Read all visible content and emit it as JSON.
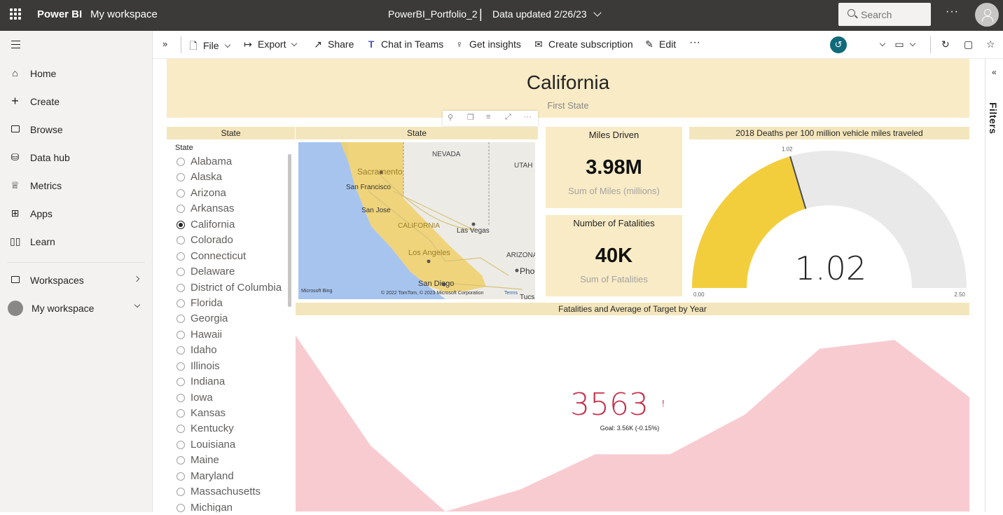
{
  "topbar": {
    "brand": "Power BI",
    "workspace_link": "My workspace",
    "report_name": "PowerBI_Portfolio_2",
    "separator": "|",
    "data_updated": "Data updated 2/26/23",
    "search_placeholder": "Search",
    "more": "···"
  },
  "nav": {
    "items": [
      {
        "label": "Home",
        "icon": "home-icon"
      },
      {
        "label": "Create",
        "icon": "plus-icon"
      },
      {
        "label": "Browse",
        "icon": "folder-icon"
      },
      {
        "label": "Data hub",
        "icon": "cylinder-icon"
      },
      {
        "label": "Metrics",
        "icon": "trophy-icon"
      },
      {
        "label": "Apps",
        "icon": "apps-icon"
      },
      {
        "label": "Learn",
        "icon": "book-icon"
      }
    ],
    "workspaces": "Workspaces",
    "my_workspace": "My workspace"
  },
  "actions": {
    "file": "File",
    "export": "Export",
    "share": "Share",
    "chat": "Chat in Teams",
    "insights": "Get insights",
    "subscription": "Create subscription",
    "edit": "Edit",
    "more": "···"
  },
  "filters_label": "Filters",
  "report": {
    "title": "California",
    "subtitle": "First State",
    "slicer_header": "State",
    "slicer_title": "State",
    "states": [
      "Alabama",
      "Alaska",
      "Arizona",
      "Arkansas",
      "California",
      "Colorado",
      "Connecticut",
      "Delaware",
      "District of Columbia",
      "Florida",
      "Georgia",
      "Hawaii",
      "Idaho",
      "Illinois",
      "Indiana",
      "Iowa",
      "Kansas",
      "Kentucky",
      "Louisiana",
      "Maine",
      "Maryland",
      "Massachusetts",
      "Michigan"
    ],
    "selected_state": "California",
    "map": {
      "header": "State",
      "labels": [
        "NEVADA",
        "UTAH",
        "Sacramento",
        "San Francisco",
        "San Jose",
        "CALIFORNIA",
        "Las Vegas",
        "ARIZONA",
        "Phoe",
        "Los Angeles",
        "San Diego",
        "Tucs"
      ],
      "attribution": "© 2022 TomTom, © 2023 Microsoft Corporation",
      "terms": "Terms",
      "bing": "Microsoft Bing",
      "colors": {
        "water": "#a7c4ef",
        "land": "#ecebe6",
        "state": "#efd270"
      }
    },
    "card_miles": {
      "title": "Miles Driven",
      "value": "3.98M",
      "subtitle": "Sum of Miles (millions)"
    },
    "card_fatalities": {
      "title": "Number of Fatalities",
      "value": "40K",
      "subtitle": "Sum of Fatalities"
    },
    "gauge": {
      "header": "2018 Deaths per 100 million vehicle miles traveled",
      "value": 1.02,
      "value_label": "1.02",
      "marker_label": "1.02",
      "min": 0,
      "max": 2.5,
      "min_label": "0.00",
      "max_label": "2.50",
      "fill_color": "#f2ce3c",
      "track_color": "#e9e9e9"
    },
    "kpi": {
      "header": "Fatalities and Average of Target by Year",
      "value": "3563",
      "indicator": "!",
      "goal_text": "Goal: 3.56K (-0.15%)",
      "value_color": "#c4314b",
      "area_color": "#f8cbd1"
    }
  },
  "chart_data": {
    "type": "area",
    "title": "Fatalities and Average of Target by Year",
    "xlabel": "",
    "ylabel": "",
    "x": [
      0,
      1,
      2,
      3,
      4,
      5,
      6,
      7,
      8,
      9
    ],
    "values": [
      3950,
      3700,
      3550,
      3600,
      3680,
      3680,
      3770,
      3920,
      3940,
      3810
    ],
    "ylim": [
      3550,
      3980
    ]
  }
}
